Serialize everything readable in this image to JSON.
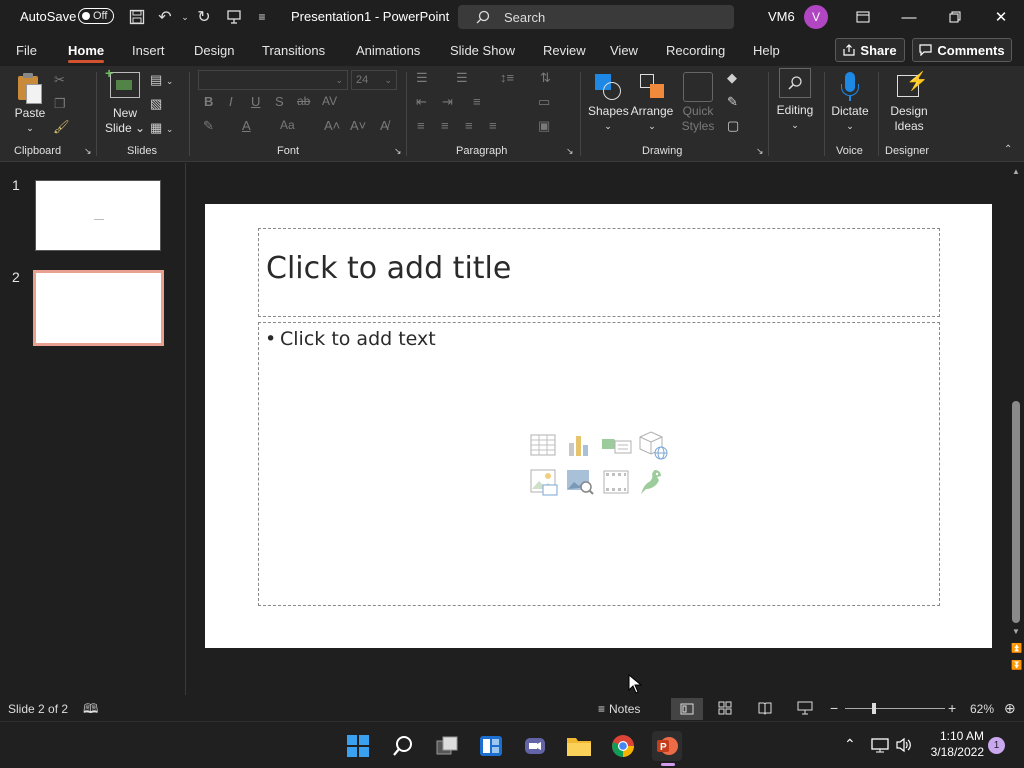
{
  "titlebar": {
    "autosave_label": "AutoSave",
    "autosave_state": "Off",
    "doc_title": "Presentation1  -  PowerPoint",
    "search_placeholder": "Search",
    "user_initials": "VM6",
    "avatar_letter": "V"
  },
  "tabs": [
    "File",
    "Home",
    "Insert",
    "Design",
    "Transitions",
    "Animations",
    "Slide Show",
    "Review",
    "View",
    "Recording",
    "Help"
  ],
  "active_tab": "Home",
  "share_label": "Share",
  "comments_label": "Comments",
  "ribbon": {
    "clipboard": {
      "paste": "Paste",
      "group": "Clipboard"
    },
    "slides": {
      "new_slide_1": "New",
      "new_slide_2": "Slide",
      "group": "Slides"
    },
    "font": {
      "size": "24",
      "group": "Font"
    },
    "paragraph": {
      "group": "Paragraph"
    },
    "drawing": {
      "shapes": "Shapes",
      "arrange": "Arrange",
      "quick_1": "Quick",
      "quick_2": "Styles",
      "group": "Drawing"
    },
    "editing": {
      "label": "Editing"
    },
    "voice": {
      "dictate": "Dictate",
      "group": "Voice"
    },
    "designer": {
      "ideas_1": "Design",
      "ideas_2": "Ideas",
      "group": "Designer"
    }
  },
  "thumbnails": [
    {
      "number": "1"
    },
    {
      "number": "2"
    }
  ],
  "slide": {
    "title_placeholder": "Click to add title",
    "content_placeholder": "Click to add text",
    "bullet": "•"
  },
  "status": {
    "slide_info": "Slide 2 of 2",
    "notes_label": "Notes",
    "zoom": "62%"
  },
  "taskbar": {
    "time": "1:10 AM",
    "date": "3/18/2022",
    "notification_count": "1"
  },
  "colors": {
    "accent": "#d35230",
    "avatar": "#b146c2",
    "selected_thumb_border": "#e8a090",
    "dictate_mic": "#1e88e5"
  }
}
